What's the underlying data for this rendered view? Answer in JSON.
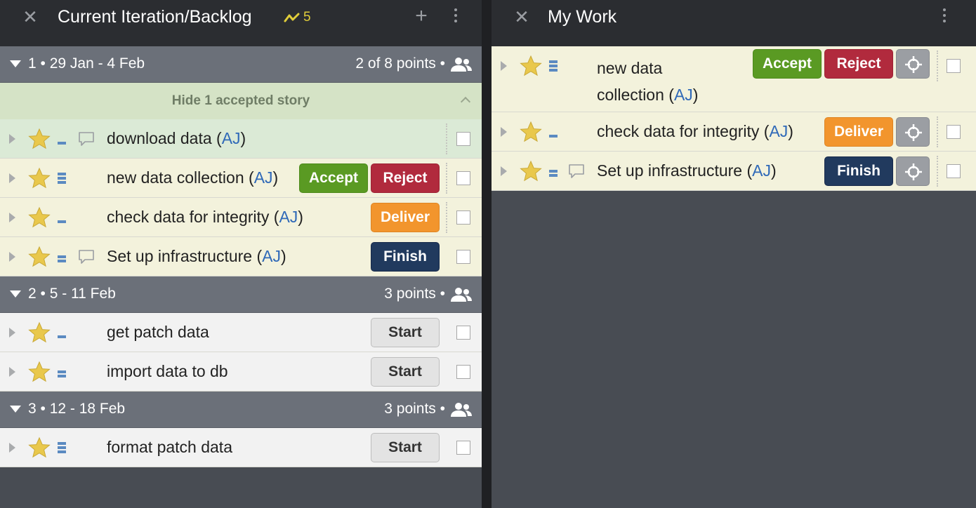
{
  "left_panel": {
    "title": "Current Iteration/Backlog",
    "velocity": "5",
    "iterations": [
      {
        "label": "1 • 29 Jan - 4 Feb",
        "points": "2 of 8 points •",
        "hide_label": "Hide 1 accepted story",
        "stories": [
          {
            "title": "download data (",
            "owner": "AJ",
            "close": ")"
          },
          {
            "title": "new data collection (",
            "owner": "AJ",
            "close": ")",
            "btn1": "Accept",
            "btn2": "Reject"
          },
          {
            "title": "check data for integrity (",
            "owner": "AJ",
            "close": ")",
            "btn1": "Deliver"
          },
          {
            "title": "Set up infrastructure (",
            "owner": "AJ",
            "close": ")",
            "btn1": "Finish"
          }
        ]
      },
      {
        "label": "2 • 5 - 11 Feb",
        "points": "3 points •",
        "stories": [
          {
            "title": "get patch data",
            "btn1": "Start"
          },
          {
            "title": "import data to db",
            "btn1": "Start"
          }
        ]
      },
      {
        "label": "3 • 12 - 18 Feb",
        "points": "3 points •",
        "stories": [
          {
            "title": "format patch data",
            "btn1": "Start"
          }
        ]
      }
    ]
  },
  "right_panel": {
    "title": "My Work",
    "stories": [
      {
        "title_line1": "new data",
        "title_line2": "collection (",
        "owner": "AJ",
        "close": ")",
        "btn1": "Accept",
        "btn2": "Reject"
      },
      {
        "title": "check data for integrity (",
        "owner": "AJ",
        "close": ")",
        "btn1": "Deliver"
      },
      {
        "title": "Set up infrastructure (",
        "owner": "AJ",
        "close": ")",
        "btn1": "Finish"
      }
    ]
  },
  "icons": {
    "close": "close-icon",
    "add": "plus-icon",
    "menu": "kebab-menu-icon",
    "velocity": "velocity-chart-icon",
    "team": "people-icon",
    "star": "star-icon",
    "comment": "comment-icon",
    "estimate": "estimate-bars-icon",
    "locate": "crosshair-icon"
  },
  "colors": {
    "accept": "#5a9a23",
    "reject": "#b12a3d",
    "deliver": "#f2952d",
    "finish": "#213a5e",
    "star": "#e9c84c",
    "owner_link": "#2f69b8"
  }
}
